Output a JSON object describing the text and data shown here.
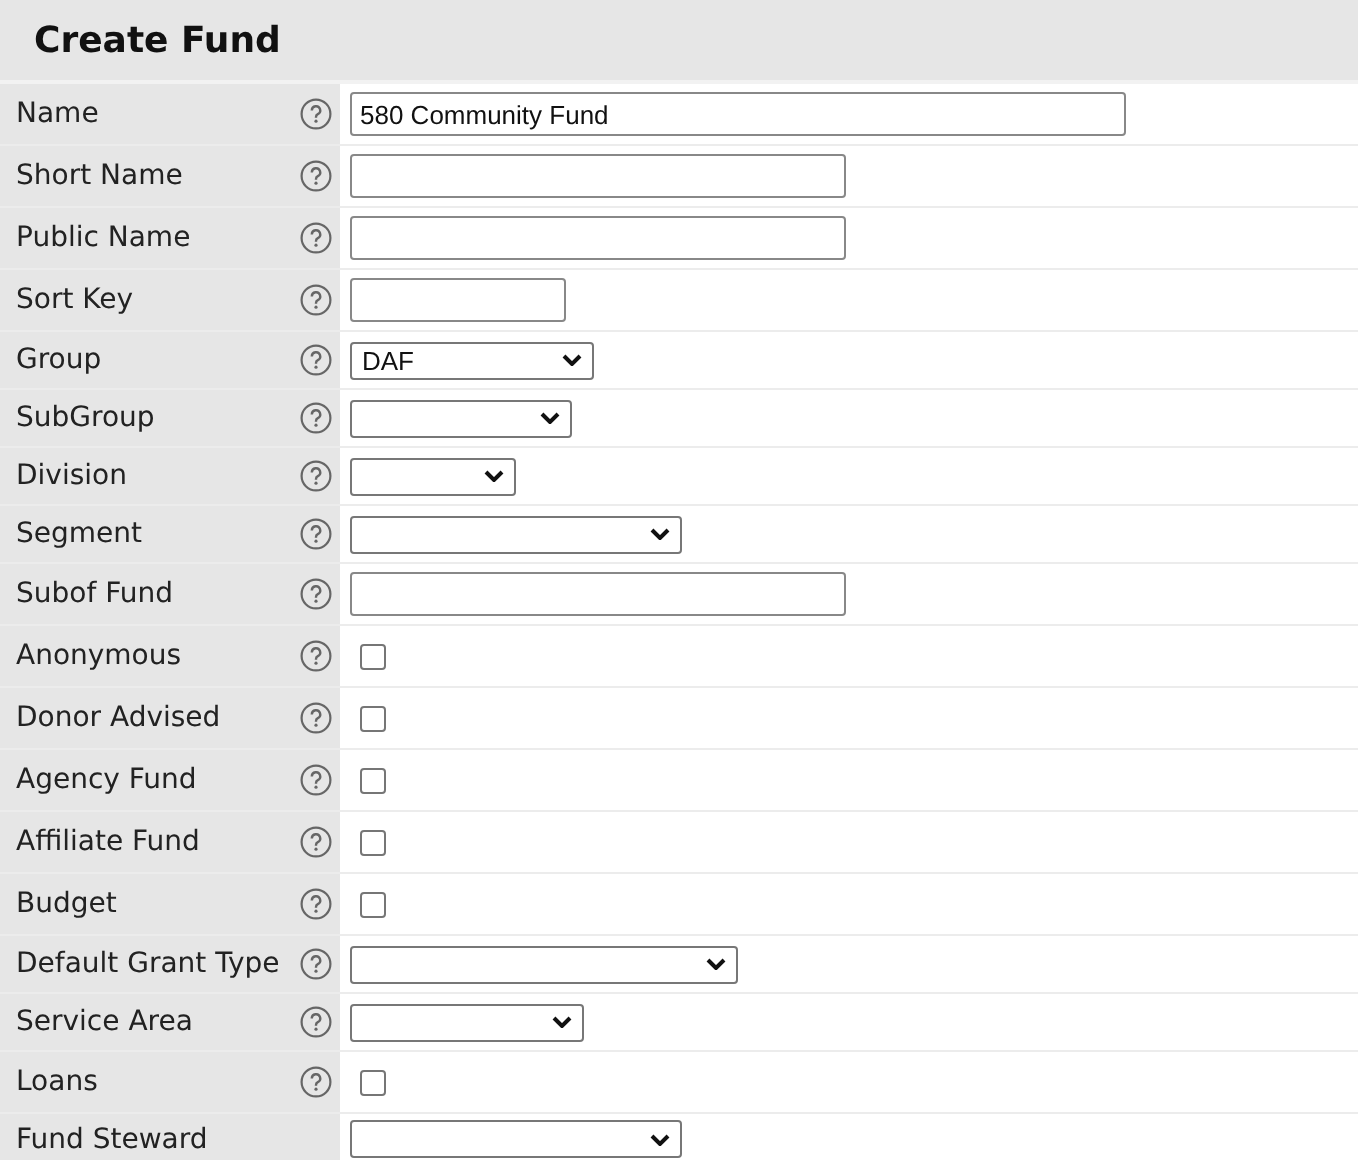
{
  "title": "Create Fund",
  "fields": [
    {
      "label": "Name",
      "help": true,
      "kind": "text",
      "value": "580 Community Fund"
    },
    {
      "label": "Short Name",
      "help": true,
      "kind": "text"
    },
    {
      "label": "Public Name",
      "help": true,
      "kind": "text"
    },
    {
      "label": "Sort Key",
      "help": true,
      "kind": "text"
    },
    {
      "label": "Group",
      "help": true,
      "kind": "select",
      "value": "DAF"
    },
    {
      "label": "SubGroup",
      "help": true,
      "kind": "select"
    },
    {
      "label": "Division",
      "help": true,
      "kind": "select"
    },
    {
      "label": "Segment",
      "help": true,
      "kind": "select"
    },
    {
      "label": "Subof Fund",
      "help": true,
      "kind": "text"
    },
    {
      "label": "Anonymous",
      "help": true,
      "kind": "checkbox",
      "checked": false
    },
    {
      "label": "Donor Advised",
      "help": true,
      "kind": "checkbox",
      "checked": false
    },
    {
      "label": "Agency Fund",
      "help": true,
      "kind": "checkbox",
      "checked": false
    },
    {
      "label": "Affiliate Fund",
      "help": true,
      "kind": "checkbox",
      "checked": false
    },
    {
      "label": "Budget",
      "help": true,
      "kind": "checkbox",
      "checked": false
    },
    {
      "label": "Default Grant Type",
      "help": true,
      "kind": "select"
    },
    {
      "label": "Service Area",
      "help": true,
      "kind": "select"
    },
    {
      "label": "Loans",
      "help": true,
      "kind": "checkbox",
      "checked": false
    },
    {
      "label": "Fund Steward",
      "help": false,
      "kind": "select"
    }
  ]
}
